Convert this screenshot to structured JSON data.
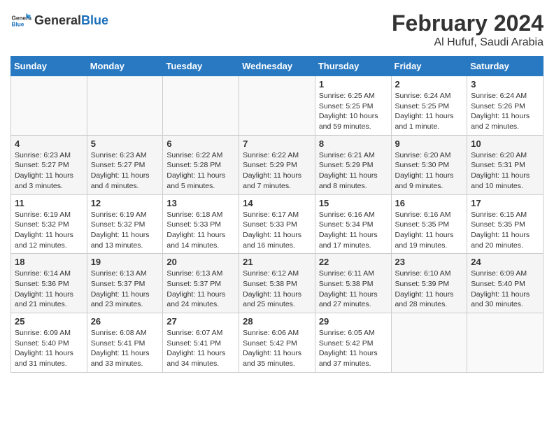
{
  "header": {
    "logo_general": "General",
    "logo_blue": "Blue",
    "month_year": "February 2024",
    "location": "Al Hufuf, Saudi Arabia"
  },
  "days_of_week": [
    "Sunday",
    "Monday",
    "Tuesday",
    "Wednesday",
    "Thursday",
    "Friday",
    "Saturday"
  ],
  "weeks": [
    [
      {
        "day": "",
        "sunrise": "",
        "sunset": "",
        "daylight": ""
      },
      {
        "day": "",
        "sunrise": "",
        "sunset": "",
        "daylight": ""
      },
      {
        "day": "",
        "sunrise": "",
        "sunset": "",
        "daylight": ""
      },
      {
        "day": "",
        "sunrise": "",
        "sunset": "",
        "daylight": ""
      },
      {
        "day": "1",
        "sunrise": "Sunrise: 6:25 AM",
        "sunset": "Sunset: 5:25 PM",
        "daylight": "Daylight: 10 hours and 59 minutes."
      },
      {
        "day": "2",
        "sunrise": "Sunrise: 6:24 AM",
        "sunset": "Sunset: 5:25 PM",
        "daylight": "Daylight: 11 hours and 1 minute."
      },
      {
        "day": "3",
        "sunrise": "Sunrise: 6:24 AM",
        "sunset": "Sunset: 5:26 PM",
        "daylight": "Daylight: 11 hours and 2 minutes."
      }
    ],
    [
      {
        "day": "4",
        "sunrise": "Sunrise: 6:23 AM",
        "sunset": "Sunset: 5:27 PM",
        "daylight": "Daylight: 11 hours and 3 minutes."
      },
      {
        "day": "5",
        "sunrise": "Sunrise: 6:23 AM",
        "sunset": "Sunset: 5:27 PM",
        "daylight": "Daylight: 11 hours and 4 minutes."
      },
      {
        "day": "6",
        "sunrise": "Sunrise: 6:22 AM",
        "sunset": "Sunset: 5:28 PM",
        "daylight": "Daylight: 11 hours and 5 minutes."
      },
      {
        "day": "7",
        "sunrise": "Sunrise: 6:22 AM",
        "sunset": "Sunset: 5:29 PM",
        "daylight": "Daylight: 11 hours and 7 minutes."
      },
      {
        "day": "8",
        "sunrise": "Sunrise: 6:21 AM",
        "sunset": "Sunset: 5:29 PM",
        "daylight": "Daylight: 11 hours and 8 minutes."
      },
      {
        "day": "9",
        "sunrise": "Sunrise: 6:20 AM",
        "sunset": "Sunset: 5:30 PM",
        "daylight": "Daylight: 11 hours and 9 minutes."
      },
      {
        "day": "10",
        "sunrise": "Sunrise: 6:20 AM",
        "sunset": "Sunset: 5:31 PM",
        "daylight": "Daylight: 11 hours and 10 minutes."
      }
    ],
    [
      {
        "day": "11",
        "sunrise": "Sunrise: 6:19 AM",
        "sunset": "Sunset: 5:32 PM",
        "daylight": "Daylight: 11 hours and 12 minutes."
      },
      {
        "day": "12",
        "sunrise": "Sunrise: 6:19 AM",
        "sunset": "Sunset: 5:32 PM",
        "daylight": "Daylight: 11 hours and 13 minutes."
      },
      {
        "day": "13",
        "sunrise": "Sunrise: 6:18 AM",
        "sunset": "Sunset: 5:33 PM",
        "daylight": "Daylight: 11 hours and 14 minutes."
      },
      {
        "day": "14",
        "sunrise": "Sunrise: 6:17 AM",
        "sunset": "Sunset: 5:33 PM",
        "daylight": "Daylight: 11 hours and 16 minutes."
      },
      {
        "day": "15",
        "sunrise": "Sunrise: 6:16 AM",
        "sunset": "Sunset: 5:34 PM",
        "daylight": "Daylight: 11 hours and 17 minutes."
      },
      {
        "day": "16",
        "sunrise": "Sunrise: 6:16 AM",
        "sunset": "Sunset: 5:35 PM",
        "daylight": "Daylight: 11 hours and 19 minutes."
      },
      {
        "day": "17",
        "sunrise": "Sunrise: 6:15 AM",
        "sunset": "Sunset: 5:35 PM",
        "daylight": "Daylight: 11 hours and 20 minutes."
      }
    ],
    [
      {
        "day": "18",
        "sunrise": "Sunrise: 6:14 AM",
        "sunset": "Sunset: 5:36 PM",
        "daylight": "Daylight: 11 hours and 21 minutes."
      },
      {
        "day": "19",
        "sunrise": "Sunrise: 6:13 AM",
        "sunset": "Sunset: 5:37 PM",
        "daylight": "Daylight: 11 hours and 23 minutes."
      },
      {
        "day": "20",
        "sunrise": "Sunrise: 6:13 AM",
        "sunset": "Sunset: 5:37 PM",
        "daylight": "Daylight: 11 hours and 24 minutes."
      },
      {
        "day": "21",
        "sunrise": "Sunrise: 6:12 AM",
        "sunset": "Sunset: 5:38 PM",
        "daylight": "Daylight: 11 hours and 25 minutes."
      },
      {
        "day": "22",
        "sunrise": "Sunrise: 6:11 AM",
        "sunset": "Sunset: 5:38 PM",
        "daylight": "Daylight: 11 hours and 27 minutes."
      },
      {
        "day": "23",
        "sunrise": "Sunrise: 6:10 AM",
        "sunset": "Sunset: 5:39 PM",
        "daylight": "Daylight: 11 hours and 28 minutes."
      },
      {
        "day": "24",
        "sunrise": "Sunrise: 6:09 AM",
        "sunset": "Sunset: 5:40 PM",
        "daylight": "Daylight: 11 hours and 30 minutes."
      }
    ],
    [
      {
        "day": "25",
        "sunrise": "Sunrise: 6:09 AM",
        "sunset": "Sunset: 5:40 PM",
        "daylight": "Daylight: 11 hours and 31 minutes."
      },
      {
        "day": "26",
        "sunrise": "Sunrise: 6:08 AM",
        "sunset": "Sunset: 5:41 PM",
        "daylight": "Daylight: 11 hours and 33 minutes."
      },
      {
        "day": "27",
        "sunrise": "Sunrise: 6:07 AM",
        "sunset": "Sunset: 5:41 PM",
        "daylight": "Daylight: 11 hours and 34 minutes."
      },
      {
        "day": "28",
        "sunrise": "Sunrise: 6:06 AM",
        "sunset": "Sunset: 5:42 PM",
        "daylight": "Daylight: 11 hours and 35 minutes."
      },
      {
        "day": "29",
        "sunrise": "Sunrise: 6:05 AM",
        "sunset": "Sunset: 5:42 PM",
        "daylight": "Daylight: 11 hours and 37 minutes."
      },
      {
        "day": "",
        "sunrise": "",
        "sunset": "",
        "daylight": ""
      },
      {
        "day": "",
        "sunrise": "",
        "sunset": "",
        "daylight": ""
      }
    ]
  ]
}
